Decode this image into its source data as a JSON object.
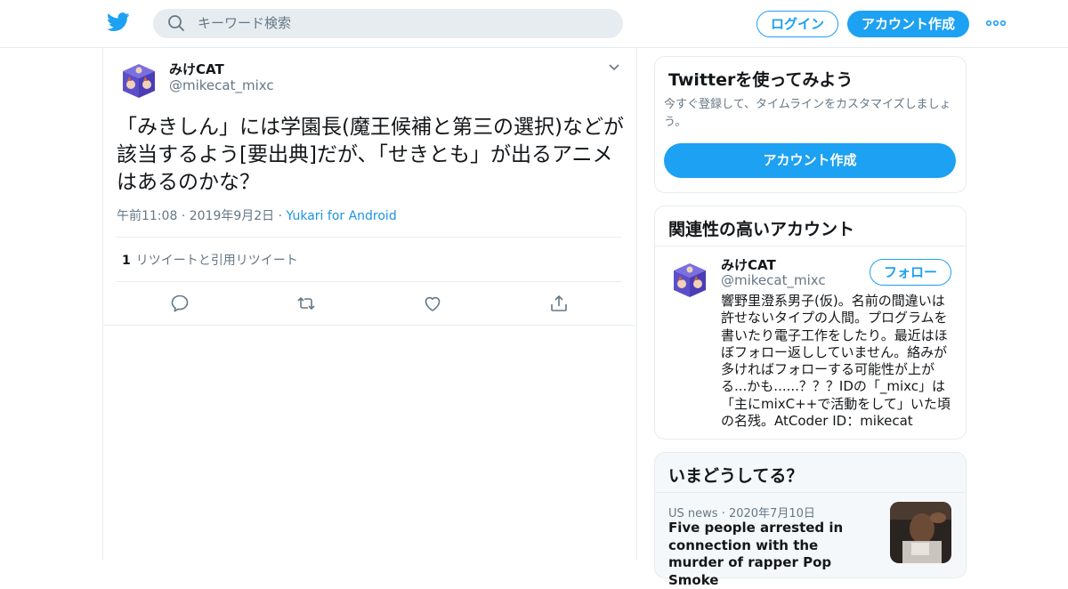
{
  "header": {
    "logo_icon": "twitter-bird-icon",
    "search_placeholder": "キーワード検索",
    "login_label": "ログイン",
    "signup_label": "アカウント作成",
    "more_icon": "more-dots-icon"
  },
  "tweet": {
    "name": "みけCAT",
    "handle": "@mikecat_mixc",
    "text": "「みきしん」には学園長(魔王候補と第三の選択)などが該当するよう[要出典]だが、「せきとも」が出るアニメはあるのかな？",
    "time": "午前11:08",
    "date": "2019年9月2日",
    "source": "Yukari for Android",
    "sep": "·",
    "retweet_count": "1",
    "retweet_label": "リツイートと引用リツイート",
    "actions": [
      "reply-icon",
      "retweet-icon",
      "like-icon",
      "share-icon"
    ]
  },
  "signup_card": {
    "title": "Twitterを使ってみよう",
    "desc": "今すぐ登録して、タイムラインをカスタマイズしましょう。",
    "button": "アカウント作成"
  },
  "related_card": {
    "title": "関連性の高いアカウント",
    "name": "みけCAT",
    "handle": "@mikecat_mixc",
    "follow_label": "フォロー",
    "bio": "響野里澄系男子(仮)。名前の間違いは許せないタイプの人間。プログラムを書いたり電子工作をしたり。最近はほぼフォロー返ししていません。絡みが多ければフォローする可能性が上がる...かも......？？？IDの「_mixc」は「主にmixC++で活動をして」いた頃の名残。AtCoder ID：mikecat"
  },
  "trends_card": {
    "title": "いまどうしてる？",
    "category": "US news",
    "date": "2020年7月10日",
    "sep": "·",
    "headline": "Five people arrested in connection with the murder of rapper Pop Smoke"
  },
  "colors": {
    "accent": "#1da1f2",
    "link": "#1b95e0",
    "muted": "#657786",
    "border": "#e6ecf0"
  }
}
